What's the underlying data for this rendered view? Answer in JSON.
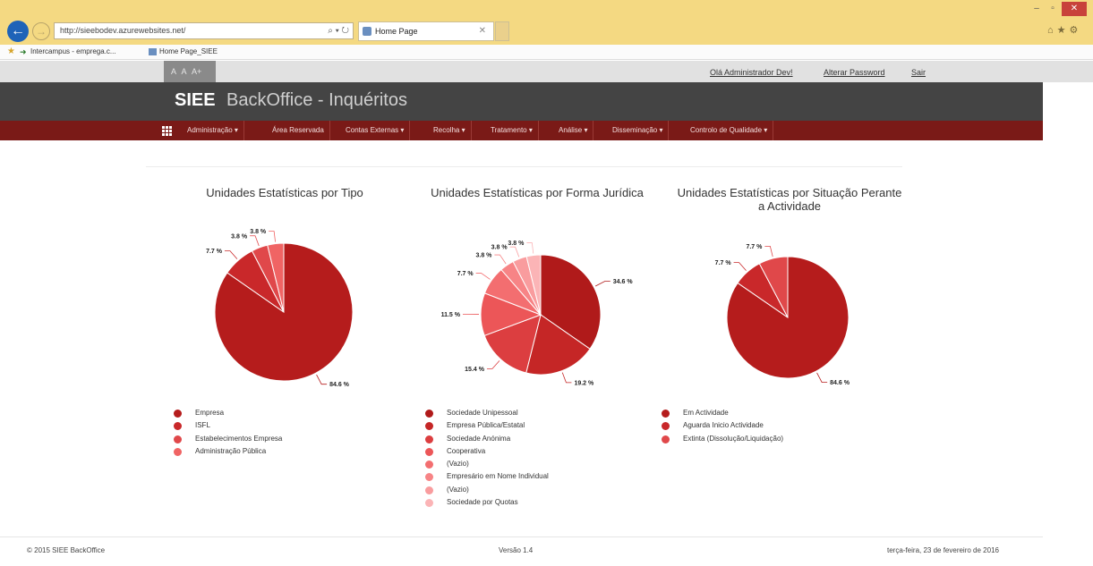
{
  "browser": {
    "url": "http://sieebodev.azurewebsites.net/",
    "url_controls": "⌕ ▾ ↻",
    "tab_title": "Home Page",
    "favorites": [
      "Intercampus - emprega.c...",
      "Home Page_SIEE"
    ],
    "window_min": "–",
    "window_max": "▫",
    "window_close": "✕",
    "right_icons": "⌂★⚙"
  },
  "util": {
    "font_sizes": "A A A+",
    "greeting": "Olá Administrador Dev!",
    "change_password": "Alterar Password",
    "logout": "Sair"
  },
  "header": {
    "brand": "SIEE",
    "subtitle": "BackOffice - Inquéritos"
  },
  "nav": {
    "items": [
      "Administração ▾",
      "Área Reservada",
      "Contas Externas ▾",
      "Recolha ▾",
      "Tratamento ▾",
      "Análise ▾",
      "Disseminação ▾",
      "Controlo de Qualidade ▾"
    ]
  },
  "chart_data": [
    {
      "type": "pie",
      "title": "Unidades Estatísticas por Tipo",
      "categories": [
        "Empresa",
        "ISFL",
        "Estabelecimentos Empresa",
        "Administração Pública"
      ],
      "values": [
        84.6,
        7.7,
        3.8,
        3.8
      ],
      "labels": [
        "84.6 %",
        "7.7 %",
        "3.8 %",
        "3.8 %"
      ],
      "colors": [
        "#b51c1c",
        "#c9282a",
        "#e0484a",
        "#f06464"
      ]
    },
    {
      "type": "pie",
      "title": "Unidades Estatísticas por Forma Jurídica",
      "categories": [
        "Sociedade Unipessoal",
        "Empresa Pública/Estatal",
        "Sociedade Anónima",
        "Cooperativa",
        "(Vazio)",
        "Empresário em Nome Individual",
        "(Vazio)",
        "Sociedade por Quotas"
      ],
      "values": [
        34.6,
        19.2,
        15.4,
        11.5,
        7.7,
        3.8,
        3.8,
        3.8
      ],
      "labels": [
        "34.6 %",
        "19.2 %",
        "15.4 %",
        "11.5 %",
        "7.7 %",
        "3.8 %",
        "3.8 %",
        "3.8 %"
      ],
      "colors": [
        "#b01a1a",
        "#c52626",
        "#dc3e40",
        "#ec5658",
        "#f36e70",
        "#f78486",
        "#f99c9e",
        "#fbb4b6"
      ]
    },
    {
      "type": "pie",
      "title": "Unidades Estatísticas por Situação Perante a Actividade",
      "categories": [
        "Em Actividade",
        "Aguarda Inicio Actividade",
        "Extinta (Dissolução/Liquidação)"
      ],
      "values": [
        84.6,
        7.7,
        7.7
      ],
      "labels": [
        "84.6 %",
        "7.7 %",
        "7.7 %"
      ],
      "colors": [
        "#b51c1c",
        "#c9282a",
        "#e0484a"
      ]
    }
  ],
  "footer": {
    "copyright": "© 2015 SIEE BackOffice",
    "version": "Versão 1.4",
    "date": "terça-feira, 23 de fevereiro de 2016"
  }
}
